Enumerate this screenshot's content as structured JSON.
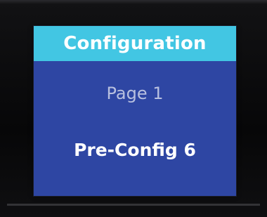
{
  "screen": {
    "title": "Configuration",
    "page_label": "Page 1",
    "selected_config": "Pre-Config 6"
  },
  "colors": {
    "title_bar": "#42c6e3",
    "screen_background": "#2e46a3",
    "page_label_text": "#b8c0df",
    "value_text": "#ffffff"
  }
}
